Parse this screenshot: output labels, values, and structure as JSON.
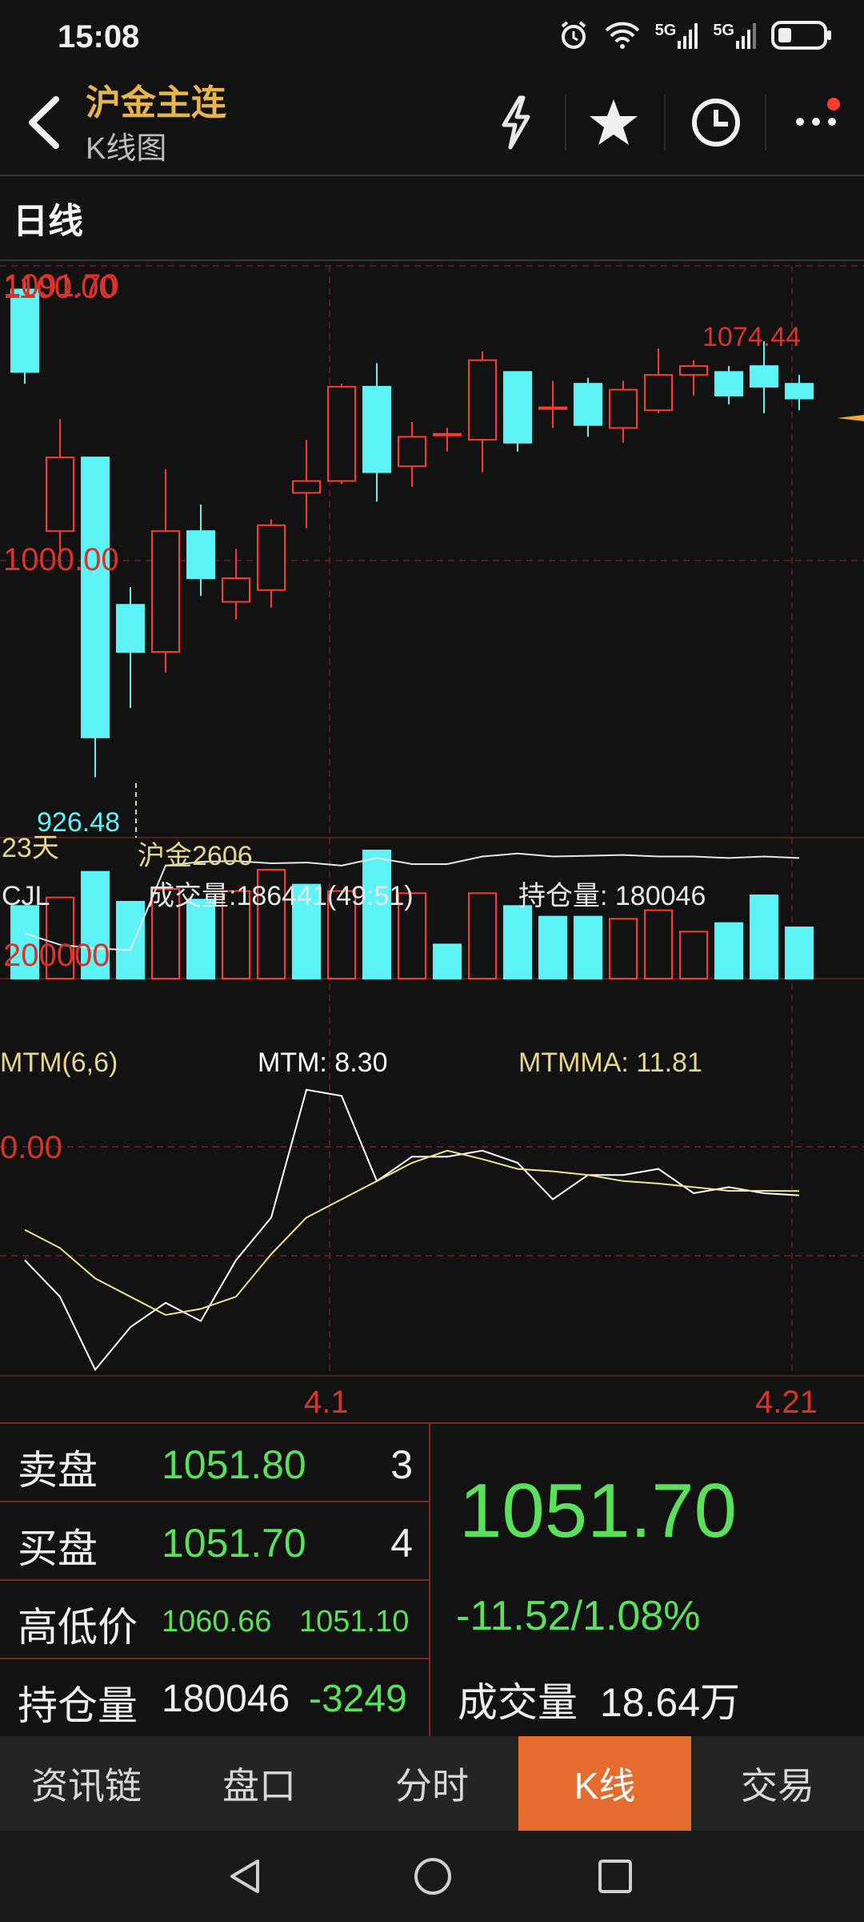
{
  "status_bar": {
    "time": "15:08",
    "signal1": "5G",
    "signal2": "5G"
  },
  "header": {
    "title": "沪金主连",
    "subtitle": "K线图",
    "icons": [
      "back-icon",
      "flash-icon",
      "star-icon",
      "history-icon",
      "more-icon"
    ],
    "accent": "#e8b54a"
  },
  "period": {
    "label": "日线"
  },
  "chart_labels": {
    "price_high_label": "1100.00",
    "price_high_overlap": "1091.70",
    "price_mid_label": "1000.00",
    "max_marker": "1074.44",
    "min_marker": "926.48",
    "days_label": "23天",
    "contract_label": "沪金2606",
    "cjl_label": "CJL",
    "volume_readout": "成交量:186441(49:51)",
    "oi_readout": "持仓量: 180046",
    "vol_axis_label": "200000",
    "mtm_label": "MTM(6,6)",
    "mtm_value": "MTM: 8.30",
    "mtmma_value": "MTMMA: 11.81",
    "mtm_zero_label": "0.00",
    "date_left": "4.1",
    "date_right": "4.21"
  },
  "chart_data": {
    "type": "candlestick",
    "colors": {
      "up": "#ff3b30",
      "down": "#5ef3f6",
      "mtm": "#ffffff",
      "mtmma": "#f0e68c",
      "volume_line": "#ffffff"
    },
    "price_range": [
      926.48,
      1100.0
    ],
    "candles": [
      {
        "o": 1092,
        "h": 1096,
        "l": 1060,
        "c": 1064
      },
      {
        "o": 1010,
        "h": 1048,
        "l": 1000,
        "c": 1035
      },
      {
        "o": 1035,
        "h": 1035,
        "l": 926.48,
        "c": 940
      },
      {
        "o": 985,
        "h": 991,
        "l": 950,
        "c": 969
      },
      {
        "o": 969,
        "h": 1031,
        "l": 962,
        "c": 1010
      },
      {
        "o": 1010,
        "h": 1019,
        "l": 988,
        "c": 994
      },
      {
        "o": 986,
        "h": 1004,
        "l": 980,
        "c": 994
      },
      {
        "o": 990,
        "h": 1014,
        "l": 984,
        "c": 1012
      },
      {
        "o": 1023,
        "h": 1041,
        "l": 1011,
        "c": 1027
      },
      {
        "o": 1027,
        "h": 1060,
        "l": 1026,
        "c": 1059
      },
      {
        "o": 1059,
        "h": 1067,
        "l": 1020,
        "c": 1030
      },
      {
        "o": 1032,
        "h": 1047,
        "l": 1025,
        "c": 1042
      },
      {
        "o": 1043,
        "h": 1045,
        "l": 1037,
        "c": 1043
      },
      {
        "o": 1041,
        "h": 1071,
        "l": 1030,
        "c": 1068
      },
      {
        "o": 1064,
        "h": 1064,
        "l": 1037,
        "c": 1040
      },
      {
        "o": 1052,
        "h": 1061,
        "l": 1045,
        "c": 1052
      },
      {
        "o": 1060,
        "h": 1062,
        "l": 1042,
        "c": 1046
      },
      {
        "o": 1045,
        "h": 1061,
        "l": 1040,
        "c": 1058
      },
      {
        "o": 1051,
        "h": 1072,
        "l": 1050,
        "c": 1063
      },
      {
        "o": 1063,
        "h": 1068,
        "l": 1056,
        "c": 1066
      },
      {
        "o": 1064,
        "h": 1066,
        "l": 1053,
        "c": 1056
      },
      {
        "o": 1066,
        "h": 1074.44,
        "l": 1050,
        "c": 1059
      },
      {
        "o": 1060,
        "h": 1063,
        "l": 1051,
        "c": 1055
      }
    ],
    "volume": [
      {
        "v": 170000,
        "up": false
      },
      {
        "v": 190000,
        "up": true
      },
      {
        "v": 250000,
        "up": false
      },
      {
        "v": 180000,
        "up": false
      },
      {
        "v": 210000,
        "up": true
      },
      {
        "v": 185000,
        "up": false
      },
      {
        "v": 205000,
        "up": true
      },
      {
        "v": 255000,
        "up": true
      },
      {
        "v": 220000,
        "up": false
      },
      {
        "v": 205000,
        "up": true
      },
      {
        "v": 300000,
        "up": false
      },
      {
        "v": 200000,
        "up": true
      },
      {
        "v": 80000,
        "up": false
      },
      {
        "v": 200000,
        "up": true
      },
      {
        "v": 170000,
        "up": false
      },
      {
        "v": 145000,
        "up": false
      },
      {
        "v": 145000,
        "up": false
      },
      {
        "v": 140000,
        "up": true
      },
      {
        "v": 160000,
        "up": true
      },
      {
        "v": 110000,
        "up": true
      },
      {
        "v": 130000,
        "up": false
      },
      {
        "v": 195000,
        "up": false
      },
      {
        "v": 120000,
        "up": false
      }
    ],
    "open_interest": [
      210000,
      195000,
      190000,
      188000,
      300000,
      305000,
      306000,
      303000,
      304000,
      300000,
      310000,
      302000,
      302000,
      312000,
      316000,
      312000,
      313000,
      314000,
      312000,
      312000,
      310000,
      312000,
      310000
    ],
    "mtm": [
      -45,
      -75,
      -135,
      -100,
      -80,
      -95,
      -45,
      -10,
      95,
      90,
      20,
      40,
      40,
      45,
      35,
      5,
      25,
      25,
      30,
      10,
      15,
      10,
      8.3
    ],
    "mtmma": [
      -20,
      -35,
      -60,
      -75,
      -90,
      -85,
      -75,
      -40,
      -10,
      5,
      20,
      35,
      45,
      38,
      30,
      28,
      25,
      20,
      18,
      15,
      12,
      12,
      11.81
    ],
    "mtm_range": [
      -140,
      110
    ]
  },
  "quote": {
    "ask_label": "卖盘",
    "ask_price": "1051.80",
    "ask_qty": "3",
    "bid_label": "买盘",
    "bid_price": "1051.70",
    "bid_qty": "4",
    "hl_label": "高低价",
    "high": "1060.66",
    "low": "1051.10",
    "oi_label": "持仓量",
    "oi": "180046",
    "oi_change": "-3249",
    "last_price": "1051.70",
    "change": "-11.52/1.08%",
    "volume_label": "成交量",
    "volume_value": "18.64万",
    "down_color": "#5be05b"
  },
  "tabs": [
    {
      "label": "资讯链",
      "active": false
    },
    {
      "label": "盘口",
      "active": false
    },
    {
      "label": "分时",
      "active": false
    },
    {
      "label": "K线",
      "active": true
    },
    {
      "label": "交易",
      "active": false
    }
  ],
  "navbar": {
    "icons": [
      "nav-back-icon",
      "nav-home-icon",
      "nav-recents-icon"
    ]
  }
}
